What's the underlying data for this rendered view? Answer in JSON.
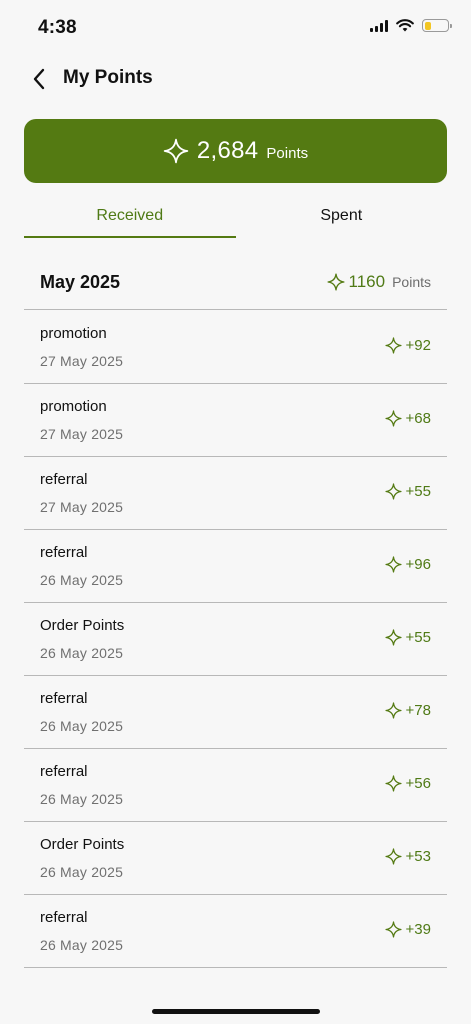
{
  "status_bar": {
    "time": "4:38"
  },
  "header": {
    "title": "My Points"
  },
  "balance": {
    "value": "2,684",
    "unit": "Points"
  },
  "tabs": [
    {
      "label": "Received",
      "active": true
    },
    {
      "label": "Spent",
      "active": false
    }
  ],
  "month": {
    "label": "May 2025",
    "total": "1160",
    "unit": "Points"
  },
  "entries": [
    {
      "title": "promotion",
      "date": "27 May 2025",
      "points": "+92"
    },
    {
      "title": "promotion",
      "date": "27 May 2025",
      "points": "+68"
    },
    {
      "title": "referral",
      "date": "27 May 2025",
      "points": "+55"
    },
    {
      "title": "referral",
      "date": "26 May 2025",
      "points": "+96"
    },
    {
      "title": "Order Points",
      "date": "26 May 2025",
      "points": "+55"
    },
    {
      "title": "referral",
      "date": "26 May 2025",
      "points": "+78"
    },
    {
      "title": "referral",
      "date": "26 May 2025",
      "points": "+56"
    },
    {
      "title": "Order Points",
      "date": "26 May 2025",
      "points": "+53"
    },
    {
      "title": "referral",
      "date": "26 May 2025",
      "points": "+39"
    }
  ],
  "colors": {
    "accent": "#547a12",
    "accent_text": "#4f7a16",
    "battery": "#f3c623"
  },
  "icons": {
    "points": "sparkle-icon",
    "back": "chevron-left-icon"
  }
}
